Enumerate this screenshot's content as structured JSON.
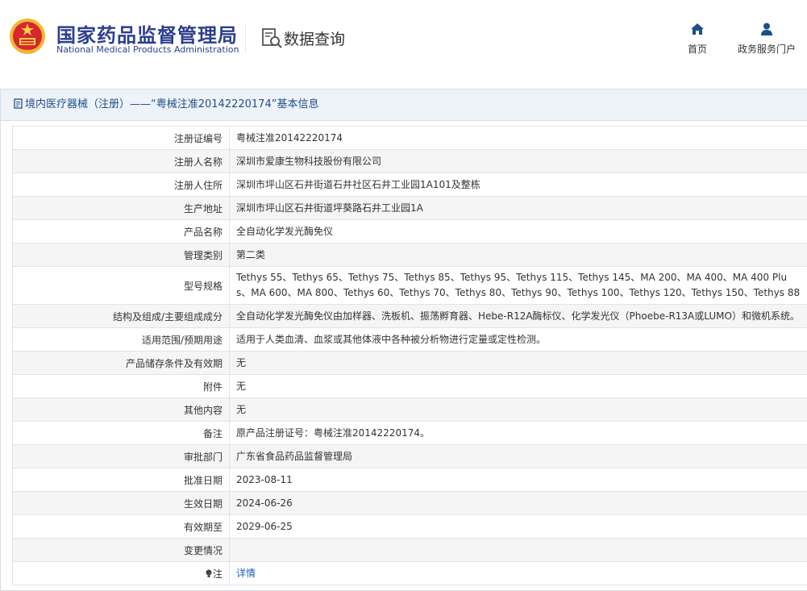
{
  "header": {
    "brand_cn": "国家药品监督管理局",
    "brand_en": "National Medical Products Administration",
    "query_label": "数据查询",
    "nav": [
      {
        "label": "首页",
        "icon": "home-icon"
      },
      {
        "label": "政务服务门户",
        "icon": "user-icon"
      }
    ]
  },
  "panel": {
    "title": "境内医疗器械（注册）——“粤械注准20142220174”基本信息"
  },
  "rows": [
    {
      "label": "注册证编号",
      "value": "粤械注准20142220174"
    },
    {
      "label": "注册人名称",
      "value": "深圳市爱康生物科技股份有限公司"
    },
    {
      "label": "注册人住所",
      "value": "深圳市坪山区石井街道石井社区石井工业园1A101及整栋"
    },
    {
      "label": "生产地址",
      "value": "深圳市坪山区石井街道坪葵路石井工业园1A"
    },
    {
      "label": "产品名称",
      "value": "全自动化学发光酶免仪"
    },
    {
      "label": "管理类别",
      "value": "第二类"
    },
    {
      "label": "型号规格",
      "value": "Tethys 55、Tethys 65、Tethys 75、Tethys 85、Tethys 95、Tethys 115、Tethys 145、MA 200、MA 400、MA 400 Plus、MA 600、MA 800、Tethys 60、Tethys 70、Tethys 80、Tethys 90、Tethys 100、Tethys 120、Tethys 150、Tethys 88"
    },
    {
      "label": "结构及组成/主要组成成分",
      "value": "全自动化学发光酶免仪由加样器、洗板机、振荡孵育器、Hebe-R12A酶标仪、化学发光仪（Phoebe-R13A或LUMO）和微机系统。"
    },
    {
      "label": "适用范围/预期用途",
      "value": "适用于人类血清、血浆或其他体液中各种被分析物进行定量或定性检测。"
    },
    {
      "label": "产品储存条件及有效期",
      "value": "无"
    },
    {
      "label": "附件",
      "value": "无"
    },
    {
      "label": "其他内容",
      "value": "无"
    },
    {
      "label": "备注",
      "value": "原产品注册证号：粤械注准20142220174。"
    },
    {
      "label": "审批部门",
      "value": "广东省食品药品监督管理局"
    },
    {
      "label": "批准日期",
      "value": "2023-08-11"
    },
    {
      "label": "生效日期",
      "value": "2024-06-26"
    },
    {
      "label": "有效期至",
      "value": "2029-06-25"
    },
    {
      "label": "变更情况",
      "value": ""
    },
    {
      "label": "注",
      "value": "详情"
    }
  ]
}
